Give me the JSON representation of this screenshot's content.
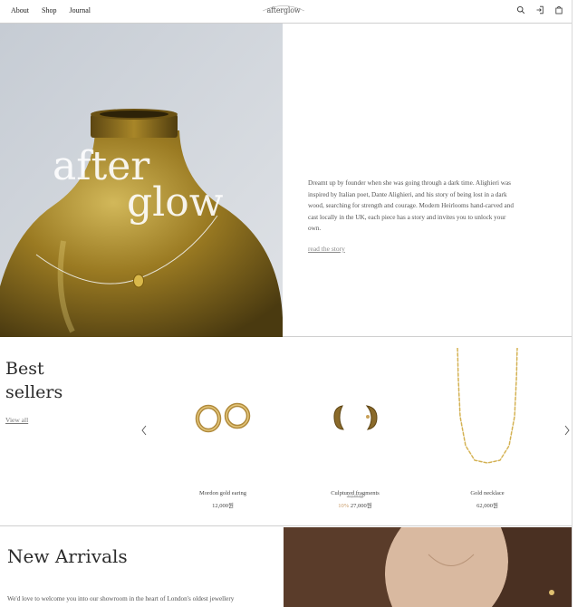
{
  "header": {
    "nav": [
      "About",
      "Shop",
      "Journal"
    ],
    "logo_text": "afterglow",
    "icons": [
      "search-icon",
      "login-icon",
      "bag-icon"
    ]
  },
  "hero": {
    "overlay_word_1": "after",
    "overlay_word_2": "glow",
    "description": "Dreamt up by founder when she was going through a dark time. Alighieri was inspired by Italian poet, Dante Alighieri, and his story of being lost in a dark wood, searching for strength and courage. Modern Heirlooms hand-carved and cast locally in the UK, each piece has a story and invites you to unlock your own.",
    "link": "read the story"
  },
  "best_sellers": {
    "title_line_1": "Best",
    "title_line_2": "sellers",
    "view_all": "View all",
    "products": [
      {
        "name": "Mordon gold earing",
        "price": "12,000원"
      },
      {
        "name": "Culptured fragments",
        "old_price": "40,000원",
        "discount": "10%",
        "price": "27,000원"
      },
      {
        "name": "Gold necklace",
        "price": "62,000원"
      }
    ]
  },
  "new_arrivals": {
    "title": "New Arrivals",
    "description": "We'd love to welcome you into our showroom in the heart of London's oldest jewellery"
  },
  "colors": {
    "border": "#cfcfcf",
    "gold": "#c9a24a",
    "discount": "#c89a66"
  }
}
